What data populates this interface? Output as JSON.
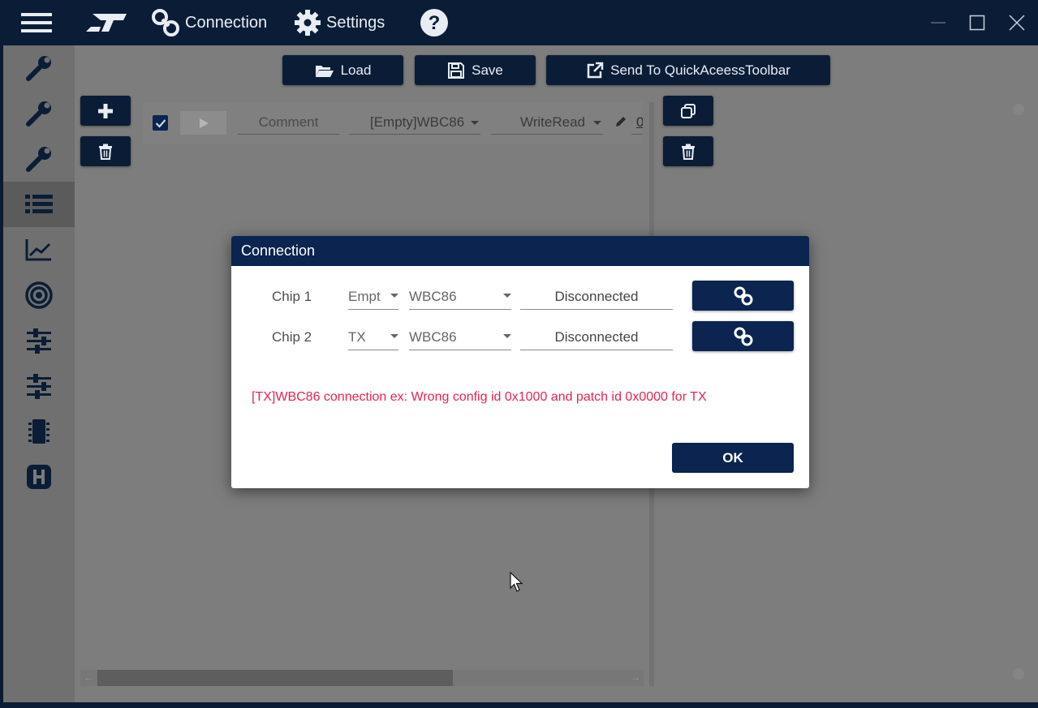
{
  "titlebar": {
    "connection_label": "Connection",
    "settings_label": "Settings"
  },
  "sidebar": {
    "items": [
      {
        "icon": "wrench-icon"
      },
      {
        "icon": "wrench-icon"
      },
      {
        "icon": "wrench-icon"
      },
      {
        "icon": "list-icon",
        "active": true
      },
      {
        "icon": "chart-line-icon"
      },
      {
        "icon": "target-icon"
      },
      {
        "icon": "sliders-icon"
      },
      {
        "icon": "sliders-icon"
      },
      {
        "icon": "chip-icon"
      },
      {
        "icon": "h-square-icon"
      }
    ]
  },
  "toolbar": {
    "load_label": "Load",
    "save_label": "Save",
    "send_label": "Send To QuickAceessToolbar"
  },
  "sequence_row": {
    "comment": "Comment",
    "target": "[Empty]WBC86",
    "operation": "WriteRead",
    "trailing_value": "0"
  },
  "dialog": {
    "title": "Connection",
    "chips": [
      {
        "label": "Chip 1",
        "mode": "Empt",
        "device": "WBC86",
        "status": "Disconnected"
      },
      {
        "label": "Chip 2",
        "mode": "TX",
        "device": "WBC86",
        "status": "Disconnected"
      }
    ],
    "error_message": "[TX]WBC86 connection ex: Wrong config id 0x1000 and patch id 0x0000 for TX",
    "ok_label": "OK"
  },
  "colors": {
    "navy": "#0b1d36",
    "dialog_header": "#0b2450",
    "error": "#e8234f"
  }
}
